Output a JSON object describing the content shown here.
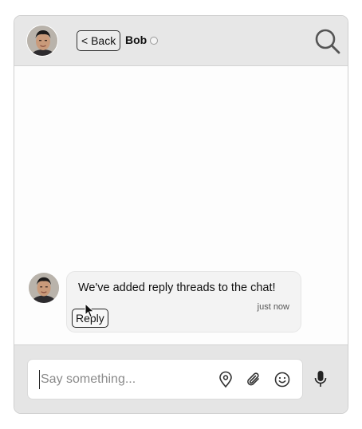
{
  "header": {
    "back_label": "< Back",
    "contact_name": "Bob",
    "presence": "offline",
    "avatar_icon": "user-avatar-photo",
    "search_icon": "search-icon"
  },
  "messages": [
    {
      "text": "We've added reply threads to the chat!",
      "time": "just now",
      "reply_label": "Reply"
    }
  ],
  "composer": {
    "placeholder": "Say something...",
    "icons": [
      "location-pin-icon",
      "paperclip-icon",
      "emoji-icon",
      "microphone-icon"
    ]
  },
  "colors": {
    "header_bg": "#e7e7e7",
    "bubble_bg": "#f3f3f3",
    "composer_bg": "#e5e5e5"
  }
}
